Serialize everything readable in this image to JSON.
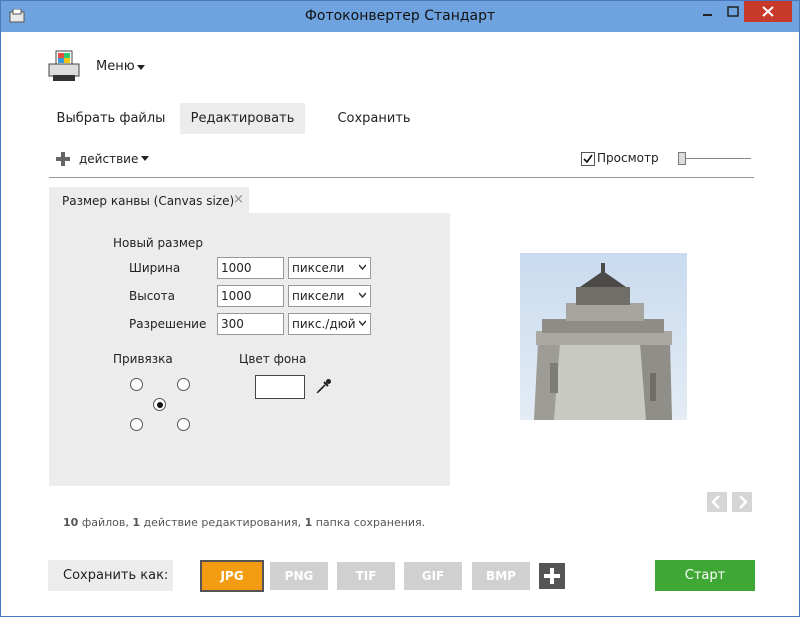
{
  "window": {
    "title": "Фотоконвертер Стандарт",
    "accent": "#6fa3e0",
    "close_color": "#c7392b"
  },
  "menu": {
    "label": "Меню"
  },
  "tabs": [
    {
      "label": "Выбрать файлы",
      "active": false
    },
    {
      "label": "Редактировать",
      "active": true
    },
    {
      "label": "Сохранить",
      "active": false
    }
  ],
  "toolbar": {
    "add_action_label": "действие",
    "preview_label": "Просмотр",
    "preview_checked": true
  },
  "panel": {
    "tab_title": "Размер канвы (Canvas size)",
    "new_size_label": "Новый размер",
    "fields": [
      {
        "label": "Ширина",
        "value": "1000",
        "unit": "пиксели"
      },
      {
        "label": "Высота",
        "value": "1000",
        "unit": "пиксели"
      },
      {
        "label": "Разрешение",
        "value": "300",
        "unit": "пикс./дюй"
      }
    ],
    "anchor_label": "Привязка",
    "bg_color_label": "Цвет фона",
    "bg_color": "#ffffff"
  },
  "summary": {
    "files_count": "10",
    "files_text": "файлов,",
    "actions_count": "1",
    "actions_text": "действие редактирования,",
    "folders_count": "1",
    "folders_text": "папка сохранения."
  },
  "footer": {
    "save_as_label": "Сохранить как:",
    "formats": [
      "JPG",
      "PNG",
      "TIF",
      "GIF",
      "BMP"
    ],
    "active_format": "JPG",
    "active_color": "#f39c12",
    "start_label": "Старт",
    "start_color": "#3fa835"
  }
}
